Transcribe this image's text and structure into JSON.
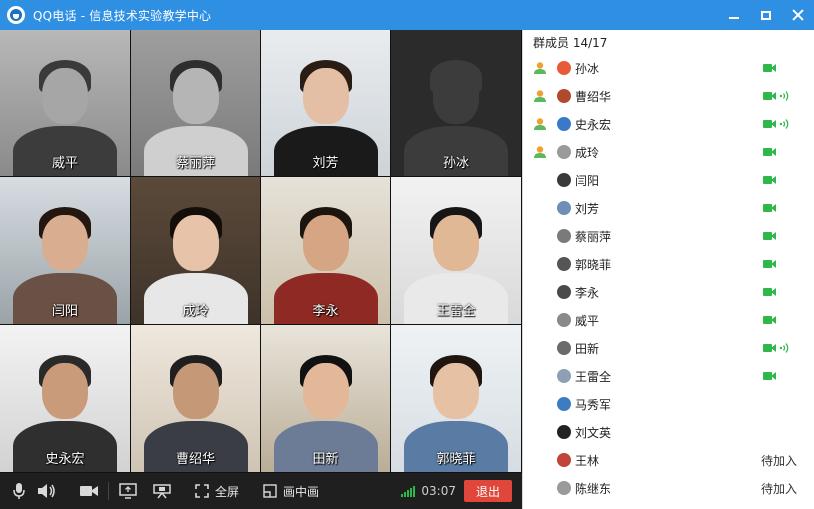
{
  "window": {
    "title": "QQ电话 - 信息技术实验教学中心",
    "accent_color": "#2f8fe3"
  },
  "video_tiles": [
    {
      "name": "威平",
      "tone": "gray"
    },
    {
      "name": "蔡丽萍",
      "tone": "gray"
    },
    {
      "name": "刘芳",
      "tone": "color"
    },
    {
      "name": "孙冰",
      "tone": "placeholder"
    },
    {
      "name": "闫阳",
      "tone": "color"
    },
    {
      "name": "成玲",
      "tone": "color"
    },
    {
      "name": "李永",
      "tone": "color"
    },
    {
      "name": "王雷全",
      "tone": "color"
    },
    {
      "name": "史永宏",
      "tone": "color"
    },
    {
      "name": "曹绍华",
      "tone": "color"
    },
    {
      "name": "田新",
      "tone": "color"
    },
    {
      "name": "郭晓菲",
      "tone": "color"
    }
  ],
  "toolbar": {
    "icons": [
      "microphone-icon",
      "speaker-icon",
      "camera-icon",
      "share-screen-icon",
      "projector-icon"
    ],
    "fullscreen_label": "全屏",
    "pip_label": "画中画",
    "timer": "03:07",
    "hangup_label": "退出",
    "hangup_color": "#e0463a",
    "signal_color": "#2fb84a"
  },
  "members": {
    "header": "群成员 14/17",
    "items": [
      {
        "name": "孙冰",
        "host": true,
        "status": "video"
      },
      {
        "name": "曹绍华",
        "host": true,
        "status": "video-speaking"
      },
      {
        "name": "史永宏",
        "host": true,
        "status": "video-speaking"
      },
      {
        "name": "成玲",
        "host": true,
        "status": "video"
      },
      {
        "name": "闫阳",
        "host": false,
        "status": "video"
      },
      {
        "name": "刘芳",
        "host": false,
        "status": "video"
      },
      {
        "name": "蔡丽萍",
        "host": false,
        "status": "video"
      },
      {
        "name": "郭晓菲",
        "host": false,
        "status": "video"
      },
      {
        "name": "李永",
        "host": false,
        "status": "video"
      },
      {
        "name": "威平",
        "host": false,
        "status": "video"
      },
      {
        "name": "田新",
        "host": false,
        "status": "video-speaking"
      },
      {
        "name": "王雷全",
        "host": false,
        "status": "video"
      },
      {
        "name": "马秀军",
        "host": false,
        "status": "none"
      },
      {
        "name": "刘文英",
        "host": false,
        "status": "none"
      },
      {
        "name": "王林",
        "host": false,
        "status": "joining",
        "status_text": "待加入"
      },
      {
        "name": "陈继东",
        "host": false,
        "status": "joining",
        "status_text": "待加入"
      }
    ]
  }
}
